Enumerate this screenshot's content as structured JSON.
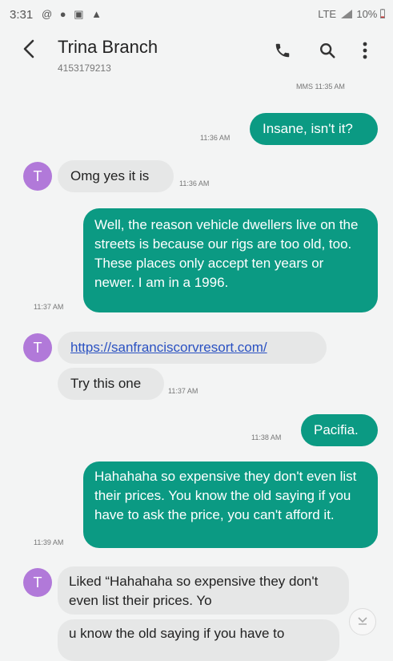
{
  "status_bar": {
    "time": "3:31",
    "left_icons": "@ ● ▣ ▲",
    "signal": "LTE",
    "battery": "10%"
  },
  "header": {
    "back_icon": "chevron-left-icon",
    "contact_name": "Trina Branch",
    "contact_number": "4153179213",
    "actions": [
      "call-icon",
      "search-icon",
      "more-icon"
    ]
  },
  "thread": {
    "mms_label": "MMS 11:35 AM",
    "contact_initial": "T",
    "messages": [
      {
        "direction": "out",
        "text": "Insane, isn't it?",
        "time": "11:36 AM"
      },
      {
        "direction": "in",
        "text": "Omg yes it is",
        "time": "11:36 AM"
      },
      {
        "direction": "out",
        "text": "Well, the reason vehicle dwellers live on the streets is because our rigs are too old, too.  These places only accept ten years or newer.  I am in a 1996.",
        "time": "11:37 AM"
      },
      {
        "direction": "in",
        "text": "https://sanfranciscorvresort.com/",
        "time": ""
      },
      {
        "direction": "in",
        "text": "Try this one",
        "time": "11:37 AM"
      },
      {
        "direction": "out",
        "text": "Pacifia.",
        "time": "11:38 AM"
      },
      {
        "direction": "out",
        "text": "Hahahaha so expensive they don't even list their prices.  You know the old saying if you have to ask the price, you can't afford it.",
        "time": "11:39 AM"
      },
      {
        "direction": "in",
        "text": "Liked “Hahahaha so expensive they don't even list their prices.  Yo",
        "time": ""
      },
      {
        "direction": "in",
        "text": "u know the old saying if you have to",
        "time": ""
      }
    ]
  },
  "colors": {
    "outgoing": "#0b9a83",
    "incoming": "#e6e7e7",
    "avatar": "#b179d9",
    "link": "#2a51c2"
  },
  "scroll_down_icon": "chevron-down-circle-icon"
}
